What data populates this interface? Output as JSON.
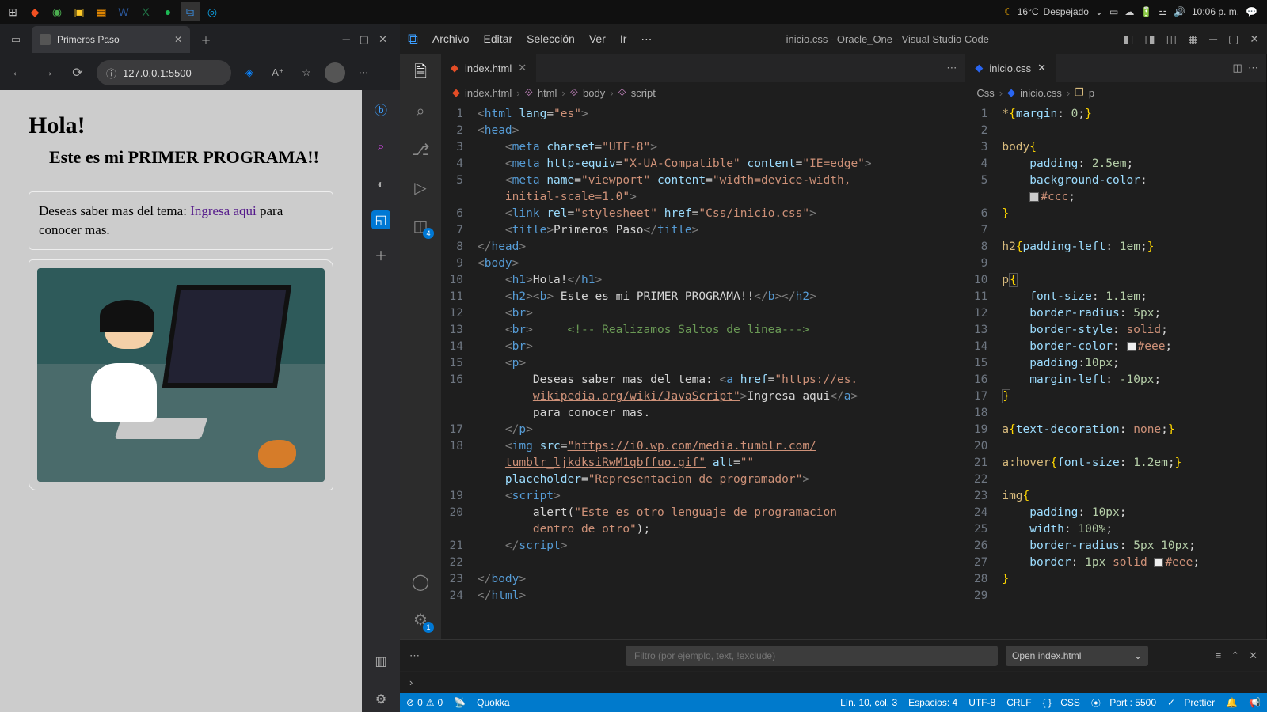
{
  "taskbar": {
    "weather_temp": "16°C",
    "weather_desc": "Despejado",
    "clock": "10:06 p. m."
  },
  "browser": {
    "tab_title": "Primeros Paso",
    "url": "127.0.0.1:5500",
    "page": {
      "h1": "Hola!",
      "h2": "Este es mi PRIMER PROGRAMA!!",
      "p_before": "Deseas saber mas del tema: ",
      "p_link": "Ingresa aqui",
      "p_after": " para conocer mas."
    }
  },
  "vscode": {
    "menu": [
      "Archivo",
      "Editar",
      "Selección",
      "Ver",
      "Ir"
    ],
    "title": "inicio.css - Oracle_One - Visual Studio Code",
    "tab1": "index.html",
    "tab2": "inicio.css",
    "breadcrumb1": [
      "index.html",
      "html",
      "body",
      "script"
    ],
    "breadcrumb2": [
      "Css",
      "inicio.css",
      "p"
    ],
    "panel_filter_placeholder": "Filtro (por ejemplo, text, !exclude)",
    "panel_open": "Open index.html",
    "ext_badge": "4",
    "gear_badge": "1",
    "status": {
      "errors": "0",
      "warnings": "0",
      "quokka": "Quokka",
      "cursor": "Lín. 10, col. 3",
      "spaces": "Espacios: 4",
      "encoding": "UTF-8",
      "eol": "CRLF",
      "lang": "CSS",
      "port": "Port : 5500",
      "prettier": "Prettier"
    }
  },
  "chart_data": null
}
